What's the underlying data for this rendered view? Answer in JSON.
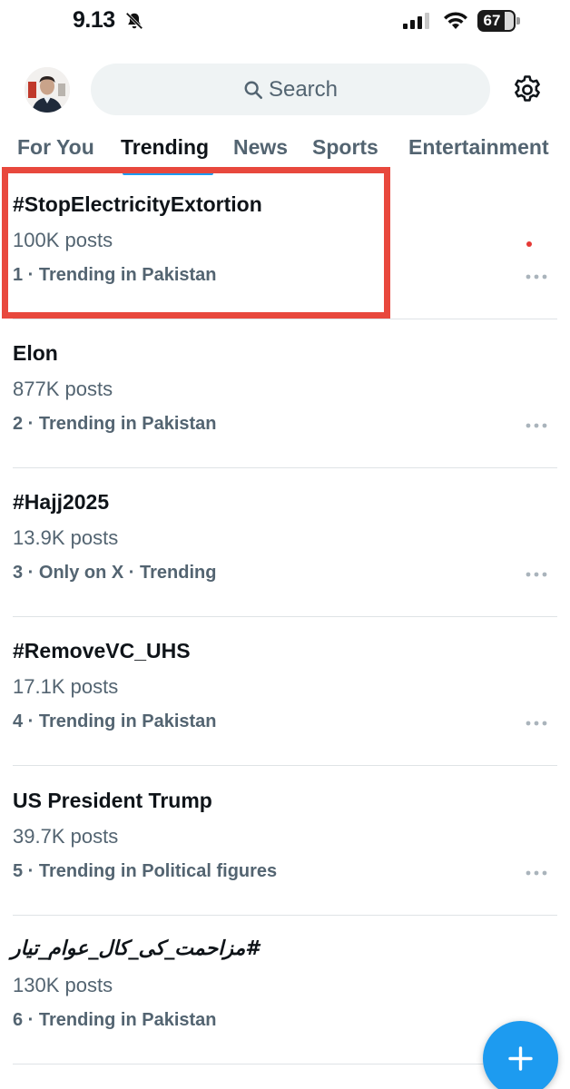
{
  "status_bar": {
    "time": "9.13",
    "battery": "67"
  },
  "header": {
    "search_placeholder": "Search"
  },
  "tabs": [
    {
      "label": "For You"
    },
    {
      "label": "Trending"
    },
    {
      "label": "News"
    },
    {
      "label": "Sports"
    },
    {
      "label": "Entertainment"
    }
  ],
  "active_tab": "Trending",
  "trends": [
    {
      "name": "#StopElectricityExtortion",
      "posts": "100K posts",
      "context": "1 · Trending in Pakistan"
    },
    {
      "name": "Elon",
      "posts": "877K posts",
      "context": "2 · Trending in Pakistan"
    },
    {
      "name": "#Hajj2025",
      "posts": "13.9K posts",
      "context": "3 · Only on X · Trending"
    },
    {
      "name": "#RemoveVC_UHS",
      "posts": "17.1K posts",
      "context": "4 · Trending in Pakistan"
    },
    {
      "name": "US President Trump",
      "posts": "39.7K posts",
      "context": "5 · Trending in Political figures"
    },
    {
      "name": "#مزاحمت_کی_کال_عوام_تیار",
      "posts": "130K posts",
      "context": "6 · Trending in Pakistan"
    }
  ],
  "colors": {
    "accent": "#1d9bf0",
    "highlight": "#e8483d",
    "text_primary": "#0f1419",
    "text_secondary": "#536471"
  },
  "icons": {
    "status": [
      "bell-off-icon",
      "signal-icon",
      "wifi-icon",
      "battery-icon"
    ],
    "header": [
      "avatar",
      "search-icon",
      "gear-icon"
    ],
    "trend_row": [
      "more-icon"
    ],
    "fab": "plus-icon"
  }
}
